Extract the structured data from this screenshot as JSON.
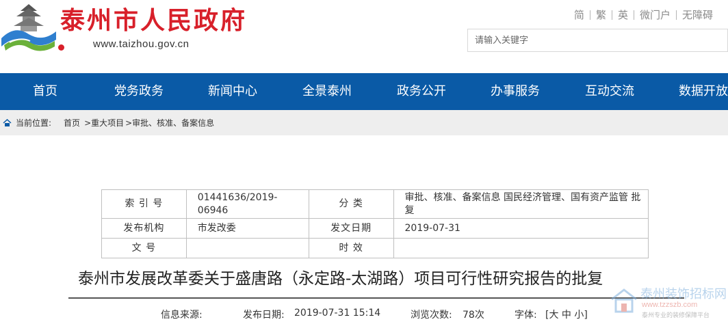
{
  "header": {
    "site_title": "泰州市人民政府",
    "site_url": "www.taizhou.gov.cn",
    "top_links": [
      "简",
      "繁",
      "英",
      "微门户",
      "无障碍"
    ],
    "search_placeholder": "请输入关键字"
  },
  "nav": {
    "items": [
      "首页",
      "党务政务",
      "新闻中心",
      "全景泰州",
      "政务公开",
      "办事服务",
      "互动交流",
      "数据开放"
    ]
  },
  "breadcrumb": {
    "label": "当前位置:",
    "items": [
      "首页",
      ">重大项目",
      ">审批、核准、备案信息"
    ]
  },
  "info_table": {
    "index_label": "索 引 号",
    "index_value": "01441636/2019-06946",
    "category_label": "分 类",
    "category_value": "审批、核准、备案信息 国民经济管理、国有资产监管 批复",
    "publisher_label": "发布机构",
    "publisher_value": "市发改委",
    "issue_date_label": "发文日期",
    "issue_date_value": "2019-07-31",
    "doc_no_label": "文 号",
    "doc_no_value": "",
    "validity_label": "时 效",
    "validity_value": ""
  },
  "article": {
    "title": "泰州市发展改革委关于盛唐路（永定路-太湖路）项目可行性研究报告的批复",
    "source_label": "信息来源:",
    "publish_date_label": "发布日期:",
    "publish_date_value": "2019-07-31 15:14",
    "views_label": "浏览次数:",
    "views_value": "78次",
    "font_label": "字体:",
    "font_sizes": "[大 中 小]"
  },
  "watermark": {
    "title": "泰州装饰招标网",
    "url": "www.tzzszb.com",
    "subtitle": "泰州专业的装修保障平台"
  },
  "colors": {
    "brand_red": "#d8202a",
    "nav_blue": "#0a5aa6",
    "breadcrumb_bg": "#eeeeee"
  }
}
